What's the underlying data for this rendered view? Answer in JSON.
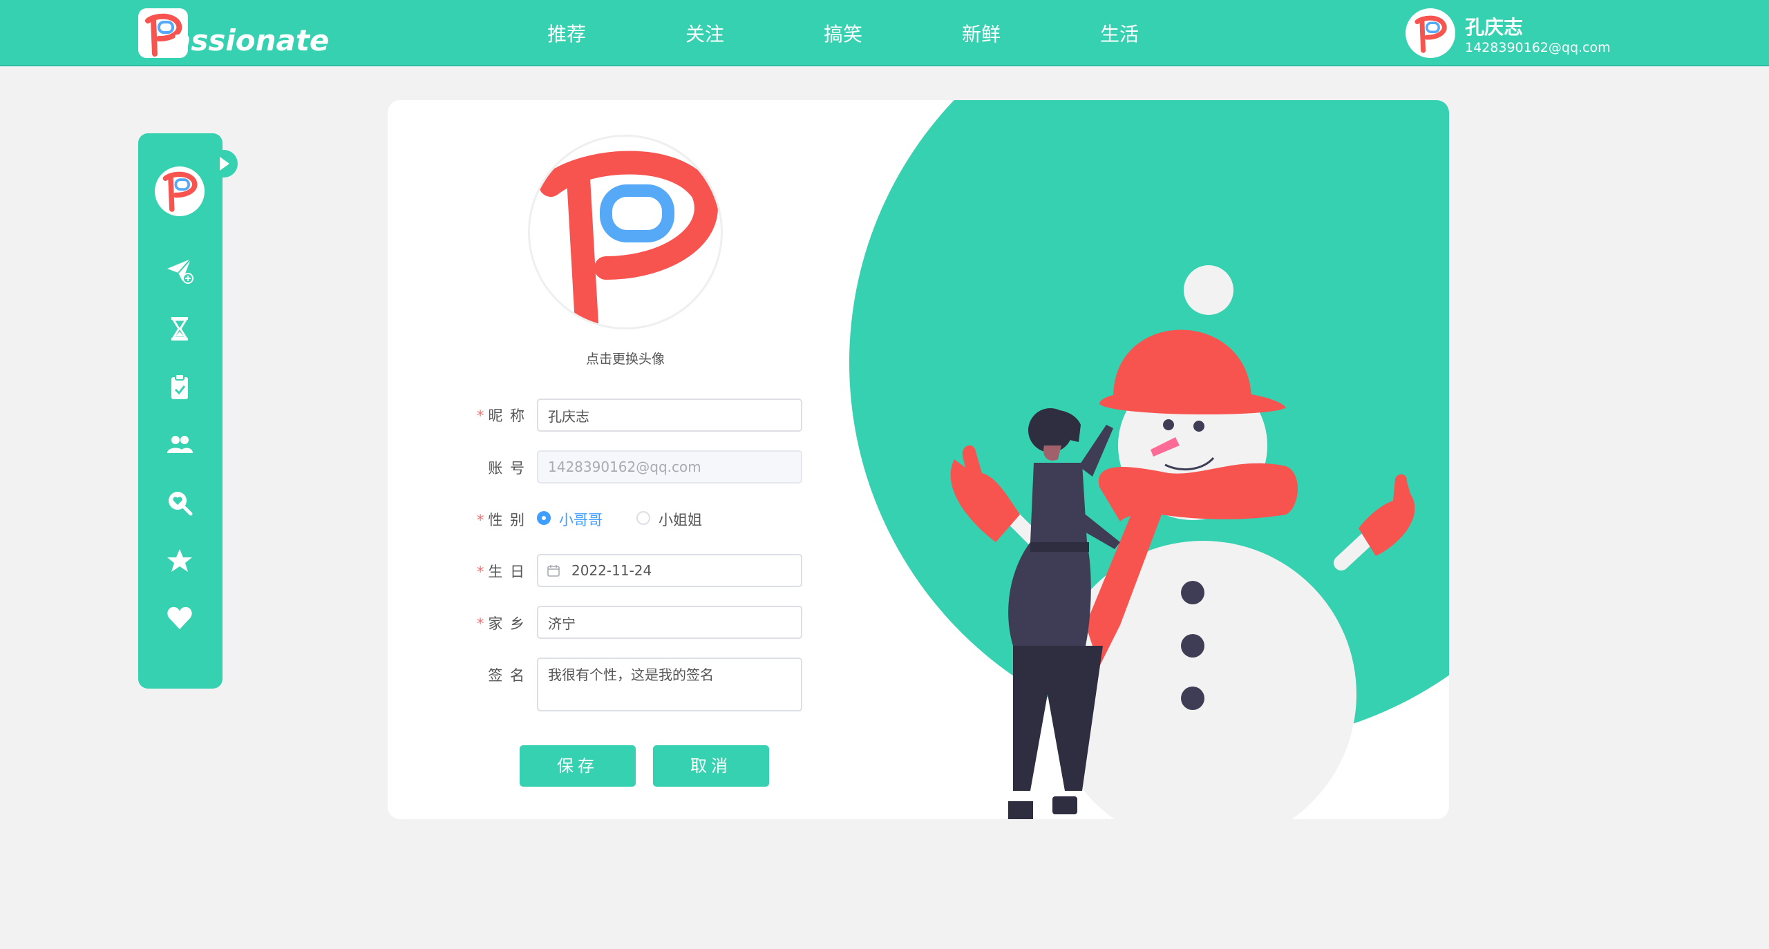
{
  "colors": {
    "accent": "#36d1b1",
    "brand_red": "#f7544f",
    "brand_blue": "#56a9f7",
    "radio_active": "#409eff",
    "required": "#f56c6c"
  },
  "header": {
    "brand": "assionate",
    "nav": [
      "推荐",
      "关注",
      "搞笑",
      "新鲜",
      "生活"
    ],
    "user": {
      "name": "孔庆志",
      "email": "1428390162@qq.com"
    }
  },
  "sidebar": {
    "icons": [
      "paper-plane-icon",
      "hourglass-icon",
      "clipboard-check-icon",
      "users-icon",
      "search-heart-icon",
      "star-icon",
      "heart-icon"
    ]
  },
  "profile": {
    "avatar_hint": "点击更换头像",
    "fields": {
      "nickname": {
        "label": "昵 称",
        "value": "孔庆志",
        "required": true
      },
      "account": {
        "label": "账 号",
        "value": "1428390162@qq.com",
        "disabled": true
      },
      "gender": {
        "label": "性 别",
        "options": [
          "小哥哥",
          "小姐姐"
        ],
        "selected": "小哥哥",
        "required": true
      },
      "birthday": {
        "label": "生 日",
        "value": "2022-11-24",
        "required": true
      },
      "hometown": {
        "label": "家 乡",
        "value": "济宁",
        "required": true
      },
      "signature": {
        "label": "签 名",
        "value": "我很有个性，这是我的签名"
      }
    },
    "required_mark": "*",
    "buttons": {
      "save": "保存",
      "cancel": "取消"
    }
  }
}
